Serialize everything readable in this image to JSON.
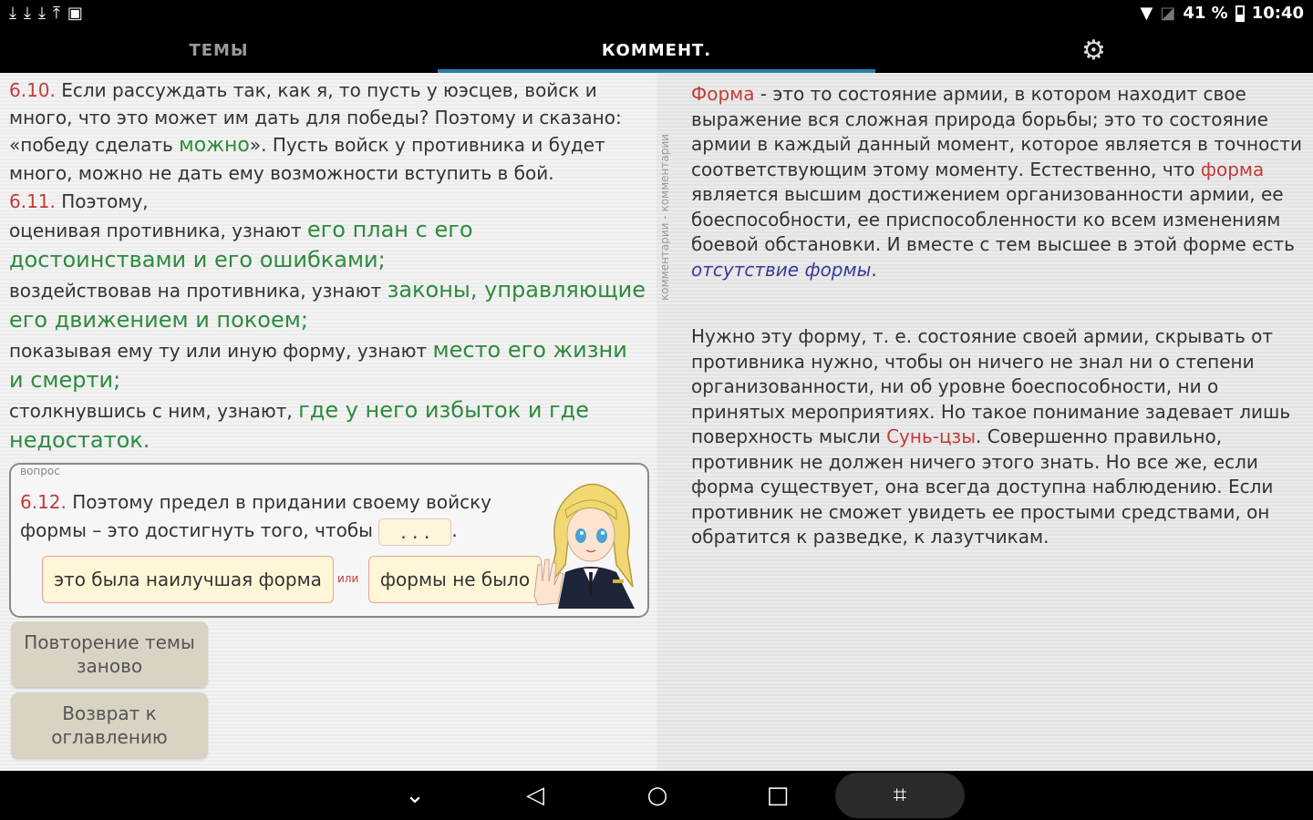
{
  "status_bar": {
    "left_icons": [
      "download-icon",
      "download-icon",
      "download-icon",
      "upload-icon",
      "image-icon"
    ],
    "battery_text": "41 %",
    "time": "10:40"
  },
  "tabs": {
    "themes": "ТЕМЫ",
    "comment": "КОММЕНТ."
  },
  "left": {
    "p610": {
      "num": "6.10.",
      "text_before": " Если рассуждать так, как я, то пусть у юэсцев,  войск и много, что это может им дать для победы? Поэтому и сказано: «победу сделать ",
      "highlight": "можно",
      "text_after": "». Пусть войск у противника и будет много, можно не дать ему возможности вступить в бой."
    },
    "p611": {
      "num": "6.11.",
      "intro": " Поэтому,",
      "line1_a": "оценивая противника, узнают ",
      "line1_b": "его план с его достоинствами и его ошибками",
      "line1_c": ";",
      "line2_a": "воздействовав на противника, узнают ",
      "line2_b": "законы, управляющие его движением и покоем",
      "line2_c": ";",
      "line3_a": "показывая ему ту или иную форму, узнают ",
      "line3_b": "место его жизни и смерти",
      "line3_c": ";",
      "line4_a": "столкнувшись с ним, узнают, ",
      "line4_b": "где у него избыток и где недостаток",
      "line4_c": "."
    },
    "question": {
      "label": "вопрос",
      "num": "6.12.",
      "text": " Поэтому предел в придании своему войску формы – это достигнуть того, чтобы ",
      "blank": ". . .",
      "end": ".",
      "answer_1": "это была наилучшая форма",
      "or": "или",
      "answer_2": "формы не было"
    },
    "buttons": {
      "repeat": "Повторение темы заново",
      "back": "Возврат к оглавлению"
    }
  },
  "right": {
    "vertical_label": "комментарии - комментарии",
    "c1": {
      "w1": "Форма",
      "t1": " - это то состояние армии, в котором находит свое выражение вся сложная природа борьбы; это то состояние армии в каждый данный момент, которое является в точности соответствующим этому моменту. Естественно, что ",
      "w2": "форма",
      "t2": " является высшим достижением организованности армии, ее боеспособности, ее приспособленности ко всем изменениям боевой обстановки. И вместе с тем высшее в этой форме есть ",
      "w3": "отсутствие формы",
      "t3": "."
    },
    "c2": {
      "t1": "Нужно эту форму, т. е. состояние своей армии, скрывать от противника нужно, чтобы он ничего не знал ни о степени организованности, ни об уровне боеспособности, ни о принятых мероприятиях. Но такое понимание задевает лишь поверхность мысли ",
      "w1": "Сунь-цзы",
      "t2": ". Совершенно правильно, противник не должен ничего этого знать. Но все же, если форма существует, она всегда доступна наблюдению. Если противник не сможет увидеть ее простыми средствами, он обратится к разведке, к лазутчикам."
    }
  },
  "nav_bar": {
    "icons": [
      "chevron-down-icon",
      "back-icon",
      "home-icon",
      "recents-icon",
      "screenshot-icon"
    ]
  },
  "colors": {
    "accent": "#2a7fa8",
    "number_red": "#c23b3b",
    "highlight_green": "#2e8b3e",
    "button_beige": "#d8d3c3"
  }
}
